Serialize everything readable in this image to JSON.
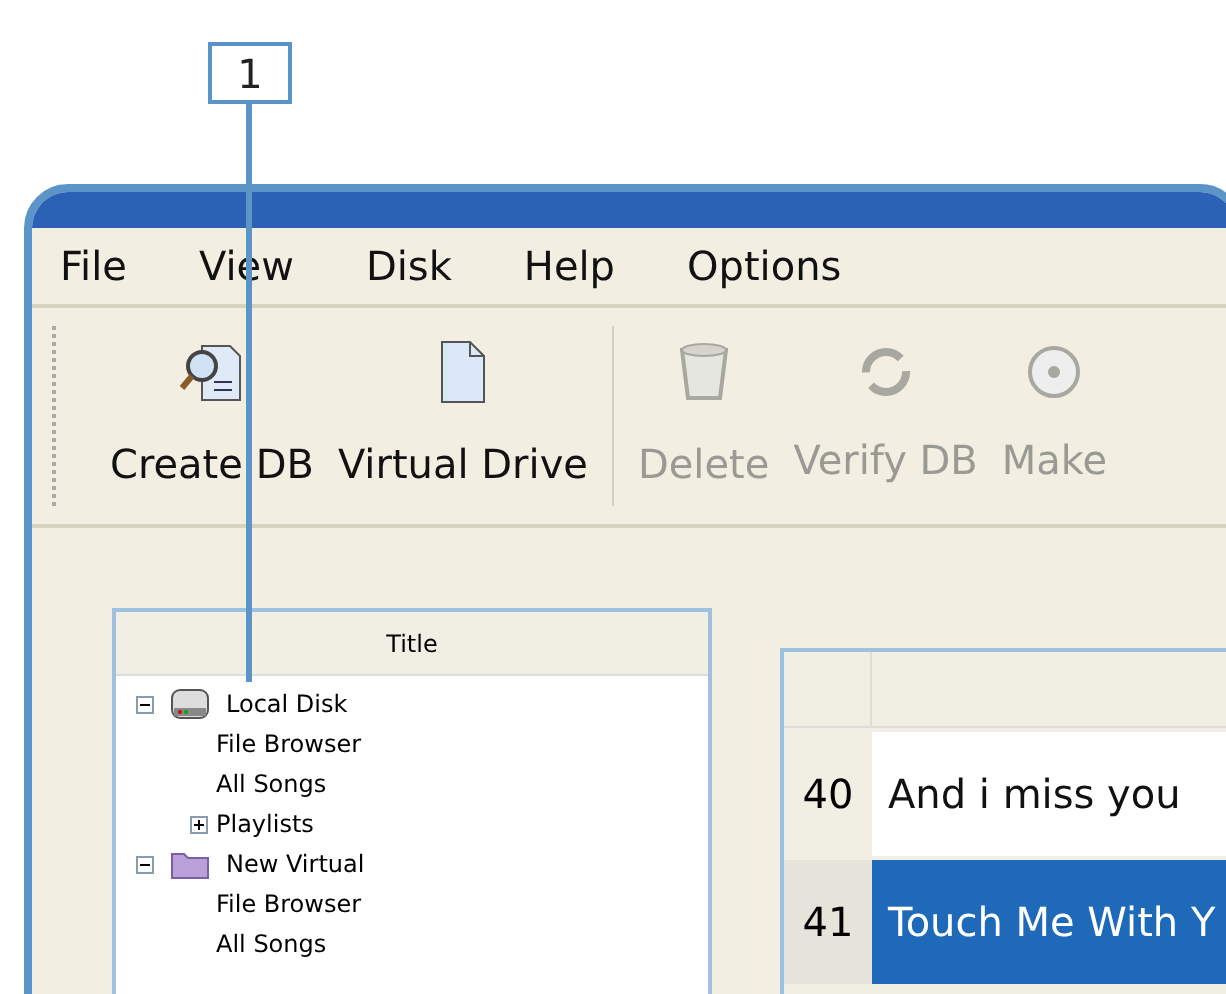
{
  "callout": {
    "label": "1"
  },
  "menu": [
    "File",
    "View",
    "Disk",
    "Help",
    "Options"
  ],
  "toolbar": [
    {
      "label": "Create DB",
      "disabled": false
    },
    {
      "label": "Virtual Drive",
      "disabled": false
    },
    {
      "label": "Delete",
      "disabled": true
    },
    {
      "label": "Verify DB",
      "disabled": true
    },
    {
      "label": "Make",
      "disabled": true
    }
  ],
  "tree": {
    "header": "Title",
    "items": [
      {
        "label": "Local Disk",
        "expanded": true,
        "children": [
          {
            "label": "File Browser"
          },
          {
            "label": "All Songs"
          },
          {
            "label": "Playlists",
            "expanded": false
          }
        ]
      },
      {
        "label": "New Virtual",
        "expanded": true,
        "children": [
          {
            "label": "File Browser"
          },
          {
            "label": "All Songs"
          }
        ]
      }
    ]
  },
  "table": {
    "rows": [
      {
        "number": "40",
        "title": "And i miss you",
        "selected": false
      },
      {
        "number": "41",
        "title": "Touch Me With Y",
        "selected": true
      }
    ]
  }
}
